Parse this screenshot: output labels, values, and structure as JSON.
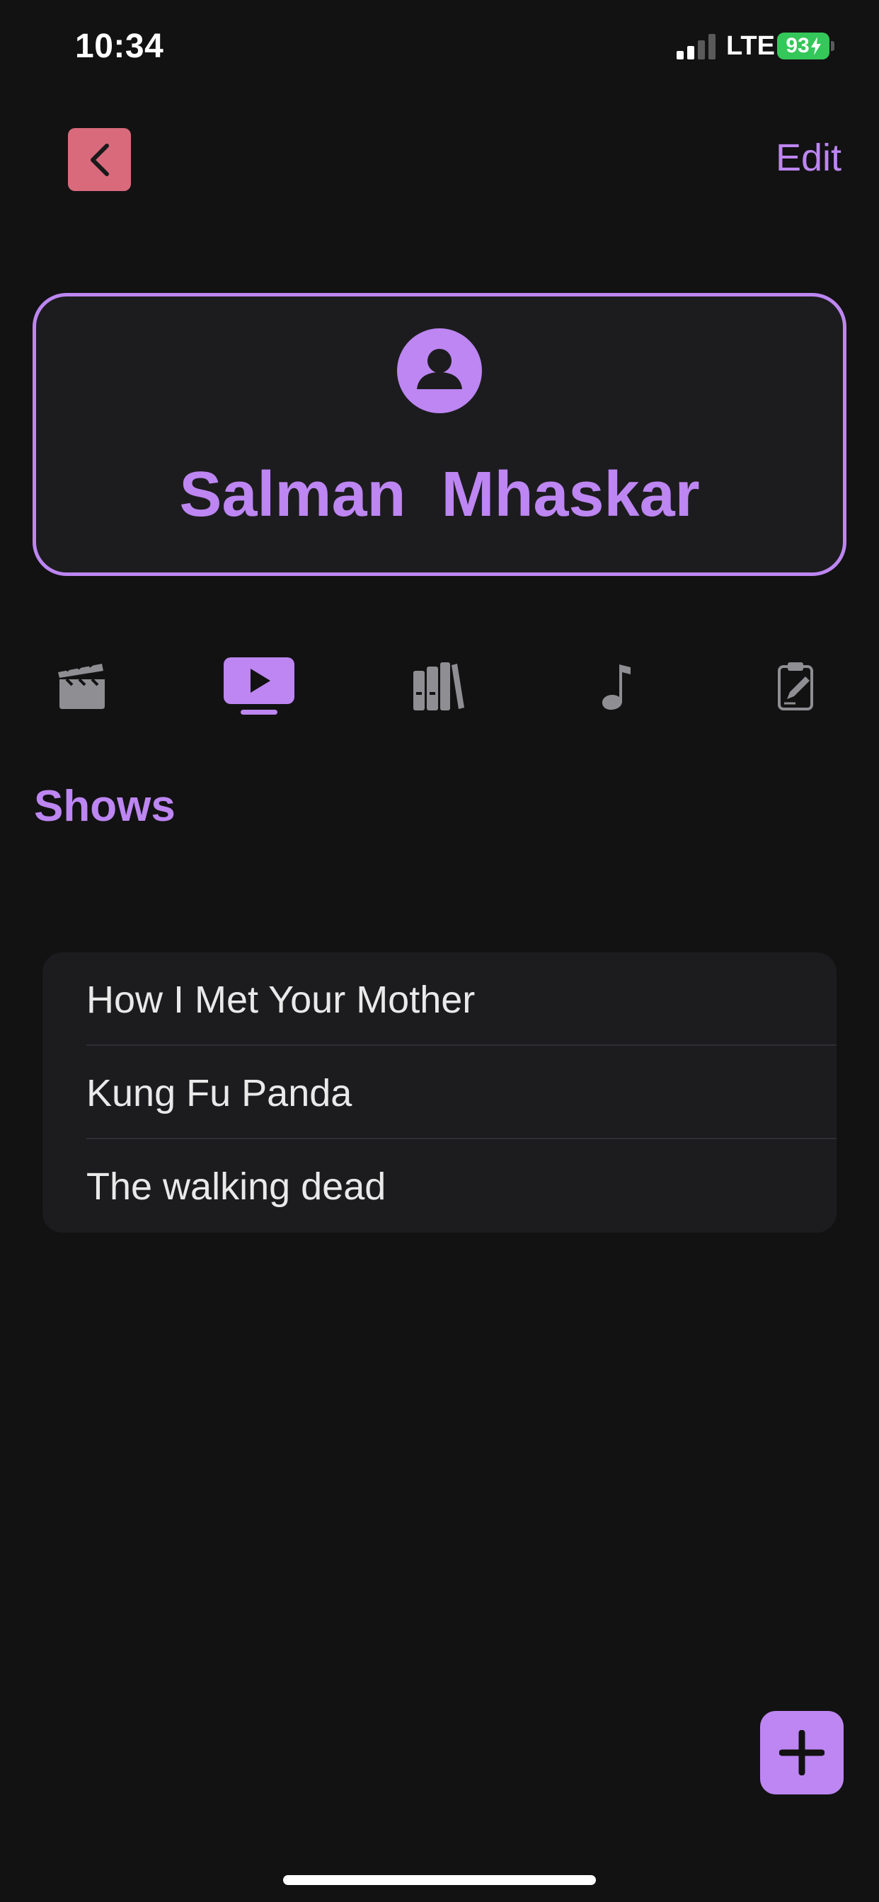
{
  "status_bar": {
    "time": "10:34",
    "network": "LTE",
    "battery": "93"
  },
  "nav": {
    "back_icon": "chevron-left-icon",
    "edit_label": "Edit"
  },
  "profile": {
    "avatar_icon": "person-circle-icon",
    "name": "Salman  Mhaskar"
  },
  "tabs": [
    {
      "icon": "clapperboard-icon",
      "selected": false
    },
    {
      "icon": "tv-play-icon",
      "selected": true
    },
    {
      "icon": "books-icon",
      "selected": false
    },
    {
      "icon": "music-note-icon",
      "selected": false
    },
    {
      "icon": "clipboard-edit-icon",
      "selected": false
    }
  ],
  "section": {
    "title": "Shows"
  },
  "shows": [
    {
      "title": "How I Met Your Mother"
    },
    {
      "title": "Kung Fu Panda"
    },
    {
      "title": "The walking dead"
    }
  ],
  "fab": {
    "icon": "plus-icon"
  },
  "colors": {
    "accent": "#bd86f2",
    "background": "#121212",
    "card": "#1c1c1e",
    "back_button": "#d96a7c",
    "battery": "#34c759",
    "inactive_icon": "#8e8e93"
  }
}
